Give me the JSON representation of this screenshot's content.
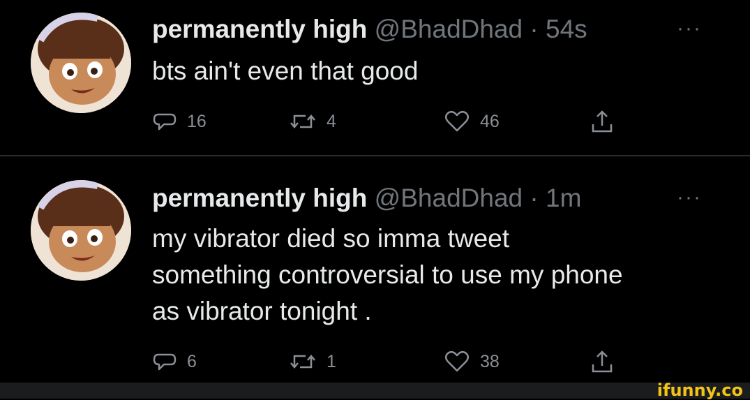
{
  "tweets": [
    {
      "name": "permanently high",
      "handle": "@BhadDhad",
      "separator": "·",
      "time": "54s",
      "lines": [
        "bts ain't even that good"
      ],
      "replies": "16",
      "retweets": "4",
      "likes": "46"
    },
    {
      "name": "permanently high",
      "handle": "@BhadDhad",
      "separator": "·",
      "time": "1m",
      "lines": [
        "my vibrator died so imma tweet",
        "something controversial to use my phone",
        "as vibrator tonight ."
      ],
      "replies": "6",
      "retweets": "1",
      "likes": "38"
    }
  ],
  "icons": {
    "more": "more-dots-icon",
    "reply": "speech-bubble-icon",
    "retweet": "retweet-arrows-icon",
    "like": "heart-icon",
    "share": "share-upload-icon"
  },
  "more_glyph": "···",
  "watermark": "ifunny.co",
  "colors": {
    "background": "#000000",
    "text": "#e7e9ea",
    "muted": "#71767b",
    "watermark": "#f2c418"
  }
}
